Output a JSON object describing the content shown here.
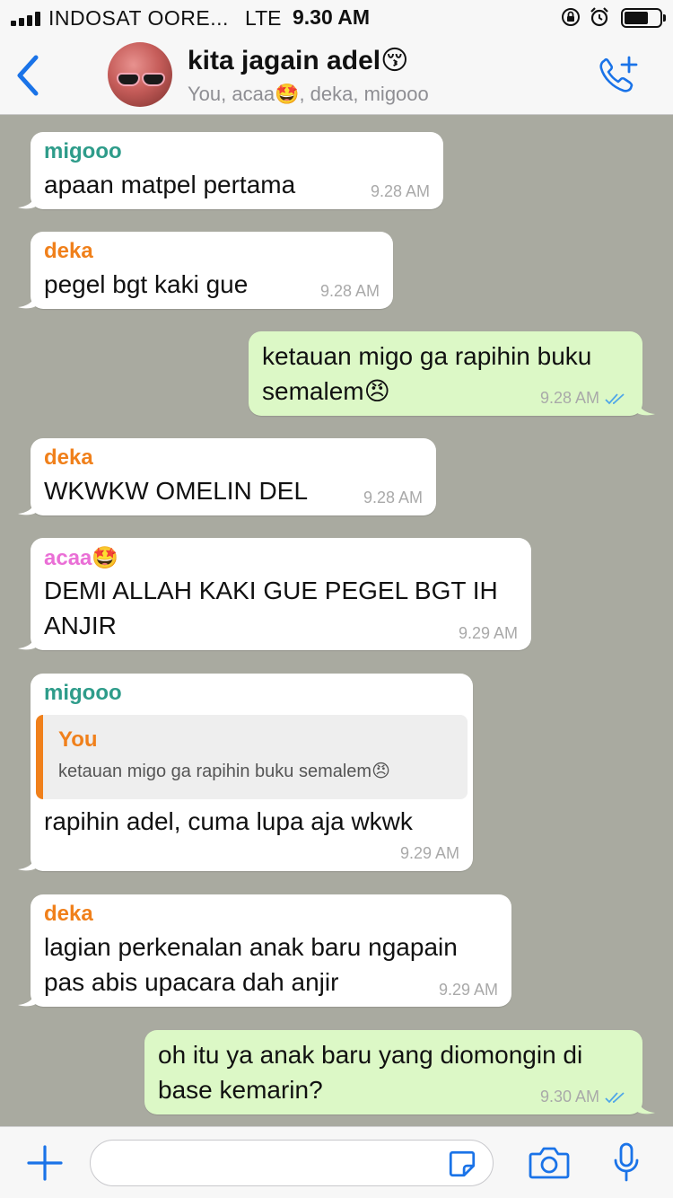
{
  "status": {
    "carrier": "INDOSAT OORE...",
    "network": "LTE",
    "time": "9.30 AM",
    "icons": [
      "signal-icon",
      "orientation-lock-icon",
      "alarm-icon",
      "battery-icon"
    ]
  },
  "header": {
    "back_icon": "chevron-left-icon",
    "title": "kita jagain adel😚",
    "subtitle": "You, acaa🤩, deka, migooo",
    "call_icon": "add-call-icon"
  },
  "messages": [
    {
      "sender": "migooo",
      "text": "apaan matpel pertama",
      "time": "9.28 AM"
    },
    {
      "sender": "deka",
      "text": "pegel bgt kaki gue",
      "time": "9.28 AM"
    },
    {
      "text": [
        "ketauan migo ga rapihin buku",
        "semalem😠"
      ],
      "time": "9.28 AM"
    },
    {
      "sender": "deka",
      "text": "WKWKW OMELIN DEL",
      "time": "9.28 AM"
    },
    {
      "sender": "acaa🤩",
      "text": [
        "DEMI ALLAH KAKI GUE PEGEL BGT IH",
        "ANJIR"
      ],
      "time": "9.29 AM"
    },
    {
      "sender": "migooo",
      "quote": {
        "author": "You",
        "text": "ketauan migo ga rapihin buku semalem😠"
      },
      "text": "rapihin adel, cuma lupa aja wkwk",
      "time": "9.29 AM"
    },
    {
      "sender": "deka",
      "text": [
        "lagian perkenalan anak baru ngapain",
        "pas abis upacara dah anjir"
      ],
      "time": "9.29 AM"
    },
    {
      "text": [
        "oh itu ya anak baru yang diomongin di",
        "base kemarin?"
      ],
      "time": "9.30 AM"
    }
  ],
  "input": {
    "placeholder": "",
    "icons": [
      "plus-icon",
      "sticker-icon",
      "camera-icon",
      "microphone-icon"
    ]
  },
  "colors": {
    "chat_background": "#a9aaa0",
    "incoming_bubble": "#ffffff",
    "outgoing_bubble": "#dcf8c6",
    "accent_blue": "#1a73e8",
    "sender_migooo": "#2e9c8a",
    "sender_deka": "#f0801b",
    "sender_acaa": "#ea6fd6",
    "read_ticks": "#4fa6e8"
  }
}
